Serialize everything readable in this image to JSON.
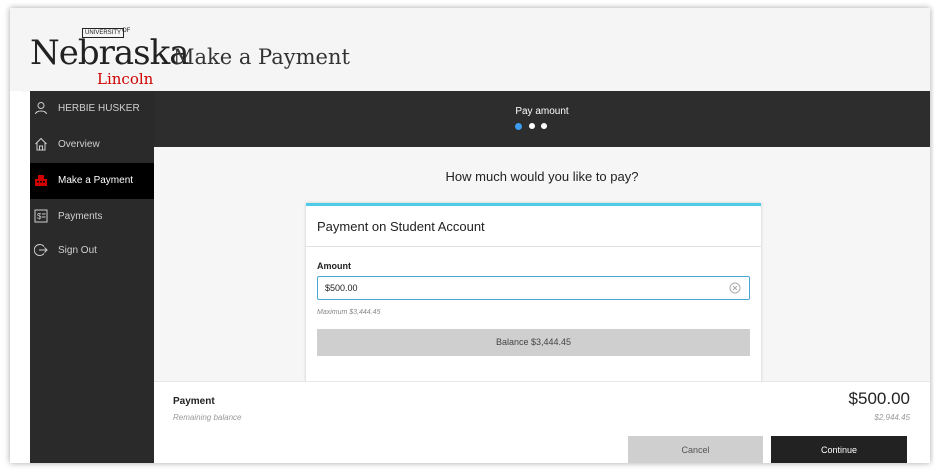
{
  "logo": {
    "main": "Nebraska",
    "univ": "UNIVERSITY",
    "of": "OF",
    "campus": "Lincoln"
  },
  "page_title": "Make a Payment",
  "sidebar": {
    "items": [
      {
        "label": "HERBIE HUSKER",
        "icon": "user-icon"
      },
      {
        "label": "Overview",
        "icon": "home-icon"
      },
      {
        "label": "Make a Payment",
        "icon": "cash-register-icon"
      },
      {
        "label": "Payments",
        "icon": "dollar-bill-icon"
      },
      {
        "label": "Sign Out",
        "icon": "sign-out-icon"
      }
    ]
  },
  "stepper": {
    "title": "Pay amount",
    "steps": 3,
    "current": 1
  },
  "form": {
    "question": "How much would you like to pay?",
    "card_title": "Payment on Student Account",
    "amount_label": "Amount",
    "amount_value": "$500.00",
    "maximum_note": "Maximum $3,444.45",
    "balance_button": "Balance $3,444.45"
  },
  "footer": {
    "payment_label": "Payment",
    "payment_amount": "$500.00",
    "remaining_label": "Remaining balance",
    "remaining_amount": "$2,944.45",
    "cancel_label": "Cancel",
    "continue_label": "Continue"
  },
  "colors": {
    "accent": "#4ecbe8",
    "brand_red": "#d00000",
    "sidebar_bg": "#2a2a2a",
    "active_dot": "#3b9cf0"
  }
}
